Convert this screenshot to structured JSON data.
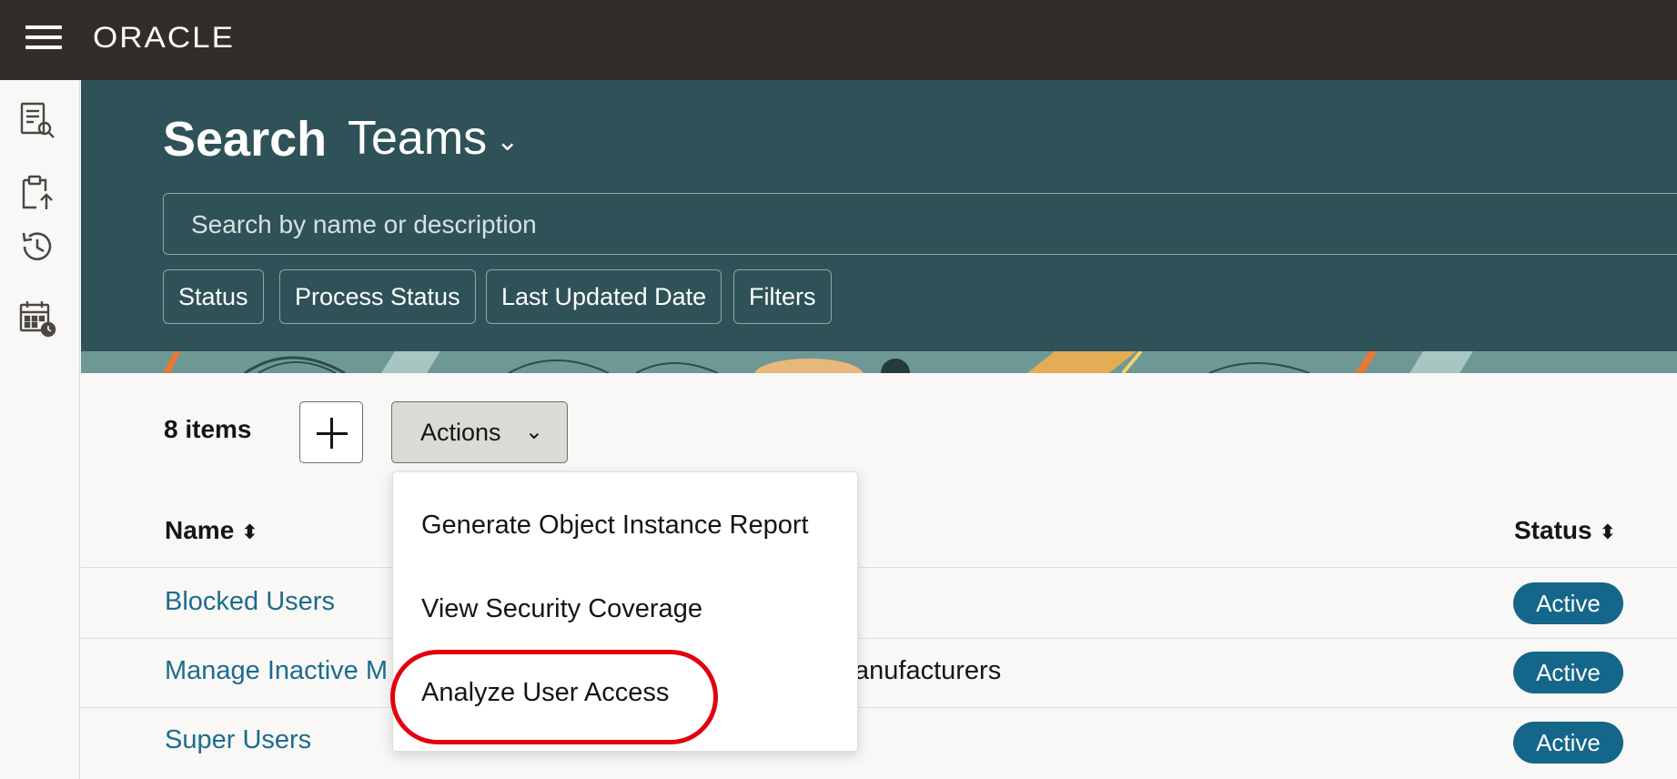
{
  "header": {
    "logo_text": "ORACLE",
    "menu_icon": "hamburger-menu-icon"
  },
  "rail": {
    "items": [
      {
        "icon": "report-search-icon"
      },
      {
        "icon": "clipboard-upload-icon"
      },
      {
        "icon": "history-icon"
      },
      {
        "icon": "calendar-clock-icon"
      }
    ]
  },
  "hero": {
    "title": "Search",
    "object": "Teams",
    "object_chevron": "⌄",
    "search_placeholder": "Search by name or description",
    "filters": [
      "Status",
      "Process Status",
      "Last Updated Date",
      "Filters"
    ]
  },
  "toolbar": {
    "items_count": "8 items",
    "add_icon": "plus-icon",
    "actions_label": "Actions",
    "actions_chevron": "⌄"
  },
  "table": {
    "columns": {
      "name": "Name",
      "status": "Status",
      "sort_glyph": "⬍"
    },
    "rows": [
      {
        "name": "Blocked Users",
        "description": "",
        "status": "Active"
      },
      {
        "name": "Manage Inactive M",
        "description": "anufacturers",
        "status": "Active"
      },
      {
        "name": "Super Users",
        "description": "",
        "status": "Active"
      }
    ]
  },
  "actions_menu": {
    "items": [
      "Generate Object Instance Report",
      "View Security Coverage",
      "Analyze User Access"
    ],
    "highlighted": "Analyze User Access"
  },
  "colors": {
    "topbar": "#312d2a",
    "hero": "#2e5257",
    "link": "#1d6b8e",
    "badge": "#14668a",
    "highlight": "#e2000f"
  }
}
